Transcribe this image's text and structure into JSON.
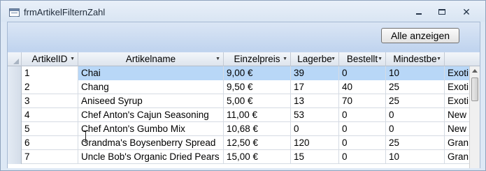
{
  "window": {
    "title": "frmArtikelFilternZahl",
    "icon": "form-icon",
    "controls": [
      "minimize",
      "maximize",
      "close"
    ]
  },
  "header": {
    "show_all_button": "Alle anzeigen"
  },
  "grid": {
    "columns": [
      "ArtikelID",
      "Artikelname",
      "Einzelpreis",
      "Lagerbe",
      "Bestellt",
      "Mindestbe",
      ""
    ],
    "selected_row": 0,
    "rows": [
      [
        "1",
        "Chai",
        "9,00 €",
        "39",
        "0",
        "10",
        "Exoti"
      ],
      [
        "2",
        "Chang",
        "9,50 €",
        "17",
        "40",
        "25",
        "Exoti"
      ],
      [
        "3",
        "Aniseed Syrup",
        "5,00 €",
        "13",
        "70",
        "25",
        "Exoti"
      ],
      [
        "4",
        "Chef Anton's Cajun Seasoning",
        "11,00 €",
        "53",
        "0",
        "0",
        "New"
      ],
      [
        "5",
        "Chef Anton's Gumbo Mix",
        "10,68 €",
        "0",
        "0",
        "0",
        "New"
      ],
      [
        "6",
        "Grandma's Boysenberry Spread",
        "12,50 €",
        "120",
        "0",
        "25",
        "Gran"
      ],
      [
        "7",
        "Uncle Bob's Organic Dried Pears",
        "15,00 €",
        "15",
        "0",
        "10",
        "Gran"
      ]
    ]
  },
  "colors": {
    "window_bg": "#dde8f5",
    "form_bg": "#c6d8f0",
    "selected_row": "#b8d7f7"
  }
}
